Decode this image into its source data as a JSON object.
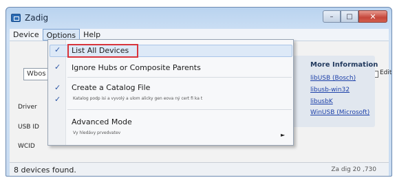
{
  "window": {
    "title": "Zadig",
    "caption_buttons": {
      "minimize": "–",
      "maximize": "□",
      "close": "✕"
    }
  },
  "menubar": {
    "items": [
      "Device",
      "Options",
      "Help"
    ]
  },
  "options_menu": {
    "items": [
      {
        "label": "List All Devices",
        "checked": true,
        "highlighted": true
      },
      {
        "label": "Ignore Hubs or Composite Parents",
        "checked": true
      },
      {
        "label": "Create a Catalog File",
        "checked": true,
        "sub": "Katalog  podp isi  a vyvolý a ulom alicky gen eova ný cert fi ka t"
      },
      {
        "label": "",
        "checked": true
      },
      {
        "label": "Advanced Mode",
        "checked": false,
        "sub": "Vy hledávy prvedvatev",
        "has_submenu": true
      }
    ],
    "highlight_color": "#d8333b"
  },
  "main": {
    "device_combo_value": "Wbos",
    "edit_label": "Edit",
    "labels": {
      "driver": "Driver",
      "usb_id": "USB ID",
      "wcid": "WCID"
    }
  },
  "info": {
    "title": "More Information",
    "links": [
      "libUSB (Bosch)",
      "libusb-win32",
      "libusbK",
      "WinUSB (Microsoft)"
    ]
  },
  "status": {
    "text": "8 devices found.",
    "version": "Za dig 20 ,730"
  }
}
